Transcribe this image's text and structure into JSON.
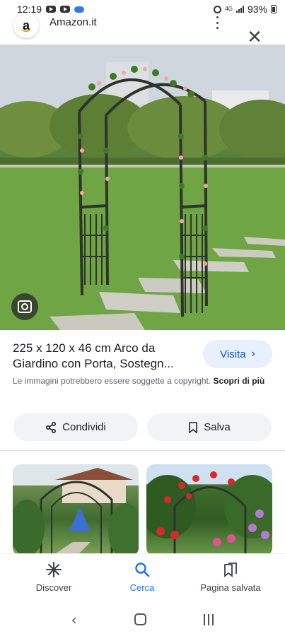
{
  "status_bar": {
    "time": "12:19",
    "network": "4G",
    "battery": "93%"
  },
  "header": {
    "logo_letter": "a",
    "site_name": "Amazon.it"
  },
  "product": {
    "title": "225 x 120 x 46 cm Arco da Giardino con Porta, Sostegn...",
    "visit_label": "Visita",
    "copyright_text": "Le immagini potrebbero essere soggette a copyright.",
    "learn_more": "Scopri di più"
  },
  "actions": {
    "share_label": "Condividi",
    "save_label": "Salva"
  },
  "bottom_nav": {
    "items": [
      {
        "label": "Discover",
        "icon": "asterisk-icon"
      },
      {
        "label": "Cerca",
        "icon": "search-icon"
      },
      {
        "label": "Pagina salvata",
        "icon": "bookmarks-icon"
      }
    ],
    "active": "Cerca"
  },
  "colors": {
    "accent": "#1a73e8",
    "visit_bg": "#e8effd",
    "button_bg": "#f1f3f4"
  }
}
